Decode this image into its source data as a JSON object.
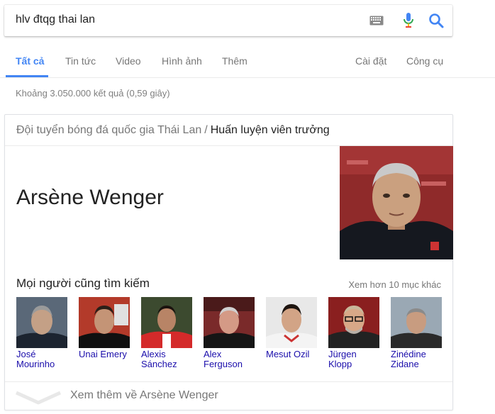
{
  "search": {
    "query": "hlv đtqg thai lan",
    "keyboard_icon": "keyboard-icon",
    "mic_icon": "microphone-icon",
    "search_icon": "search-icon"
  },
  "tabs": {
    "items": [
      {
        "label": "Tất cả",
        "active": true
      },
      {
        "label": "Tin tức"
      },
      {
        "label": "Video"
      },
      {
        "label": "Hình ảnh"
      },
      {
        "label": "Thêm"
      }
    ],
    "settings": "Cài đặt",
    "tools": "Công cụ"
  },
  "result_stats": "Khoảng 3.050.000 kết quả (0,59 giây)",
  "card": {
    "breadcrumb_parent": "Đội tuyển bóng đá quốc gia Thái Lan",
    "breadcrumb_sep": "/",
    "breadcrumb_current": "Huấn luyện viên trưởng",
    "name": "Arsène Wenger",
    "people_also_search": "Mọi người cũng tìm kiếm",
    "view_more": "Xem hơn 10 mục khác",
    "people": [
      {
        "name": "José Mourinho"
      },
      {
        "name": "Unai Emery"
      },
      {
        "name": "Alexis Sánchez"
      },
      {
        "name": "Alex Ferguson"
      },
      {
        "name": "Mesut Ozil"
      },
      {
        "name": "Jürgen Klopp"
      },
      {
        "name": "Zinédine Zidane"
      }
    ],
    "see_more_about": "Xem thêm về Arsène Wenger"
  },
  "colors": {
    "accent": "#4285f4",
    "link": "#1a0dab",
    "muted": "#777777"
  }
}
